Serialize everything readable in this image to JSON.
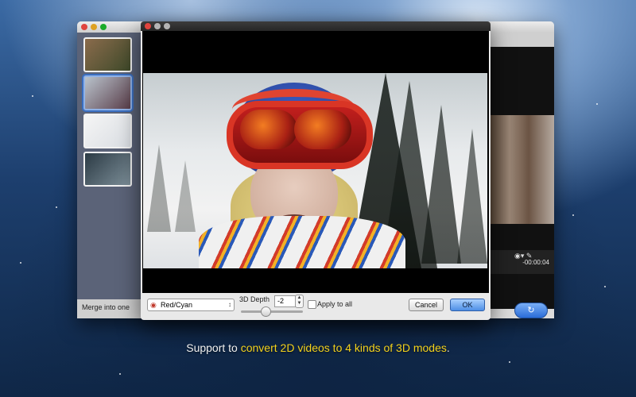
{
  "back_window": {
    "merge_label": "Merge into one",
    "timecode": "-00:00:04",
    "camera_icon": "camera-icon",
    "edit_icon": "edit-icon",
    "convert_icon": "refresh-arrow-icon"
  },
  "dialog": {
    "mode_select_value": "Red/Cyan",
    "depth_label": "3D Depth",
    "depth_value": "-2",
    "depth_slider_fraction": 0.4,
    "apply_all_label": "Apply to all",
    "apply_all_checked": false,
    "cancel_label": "Cancel",
    "ok_label": "OK"
  },
  "caption": {
    "prefix": "Support to ",
    "highlight": "convert 2D videos to 4 kinds of 3D modes",
    "suffix": ".",
    "highlight_color": "#f3d21d"
  }
}
